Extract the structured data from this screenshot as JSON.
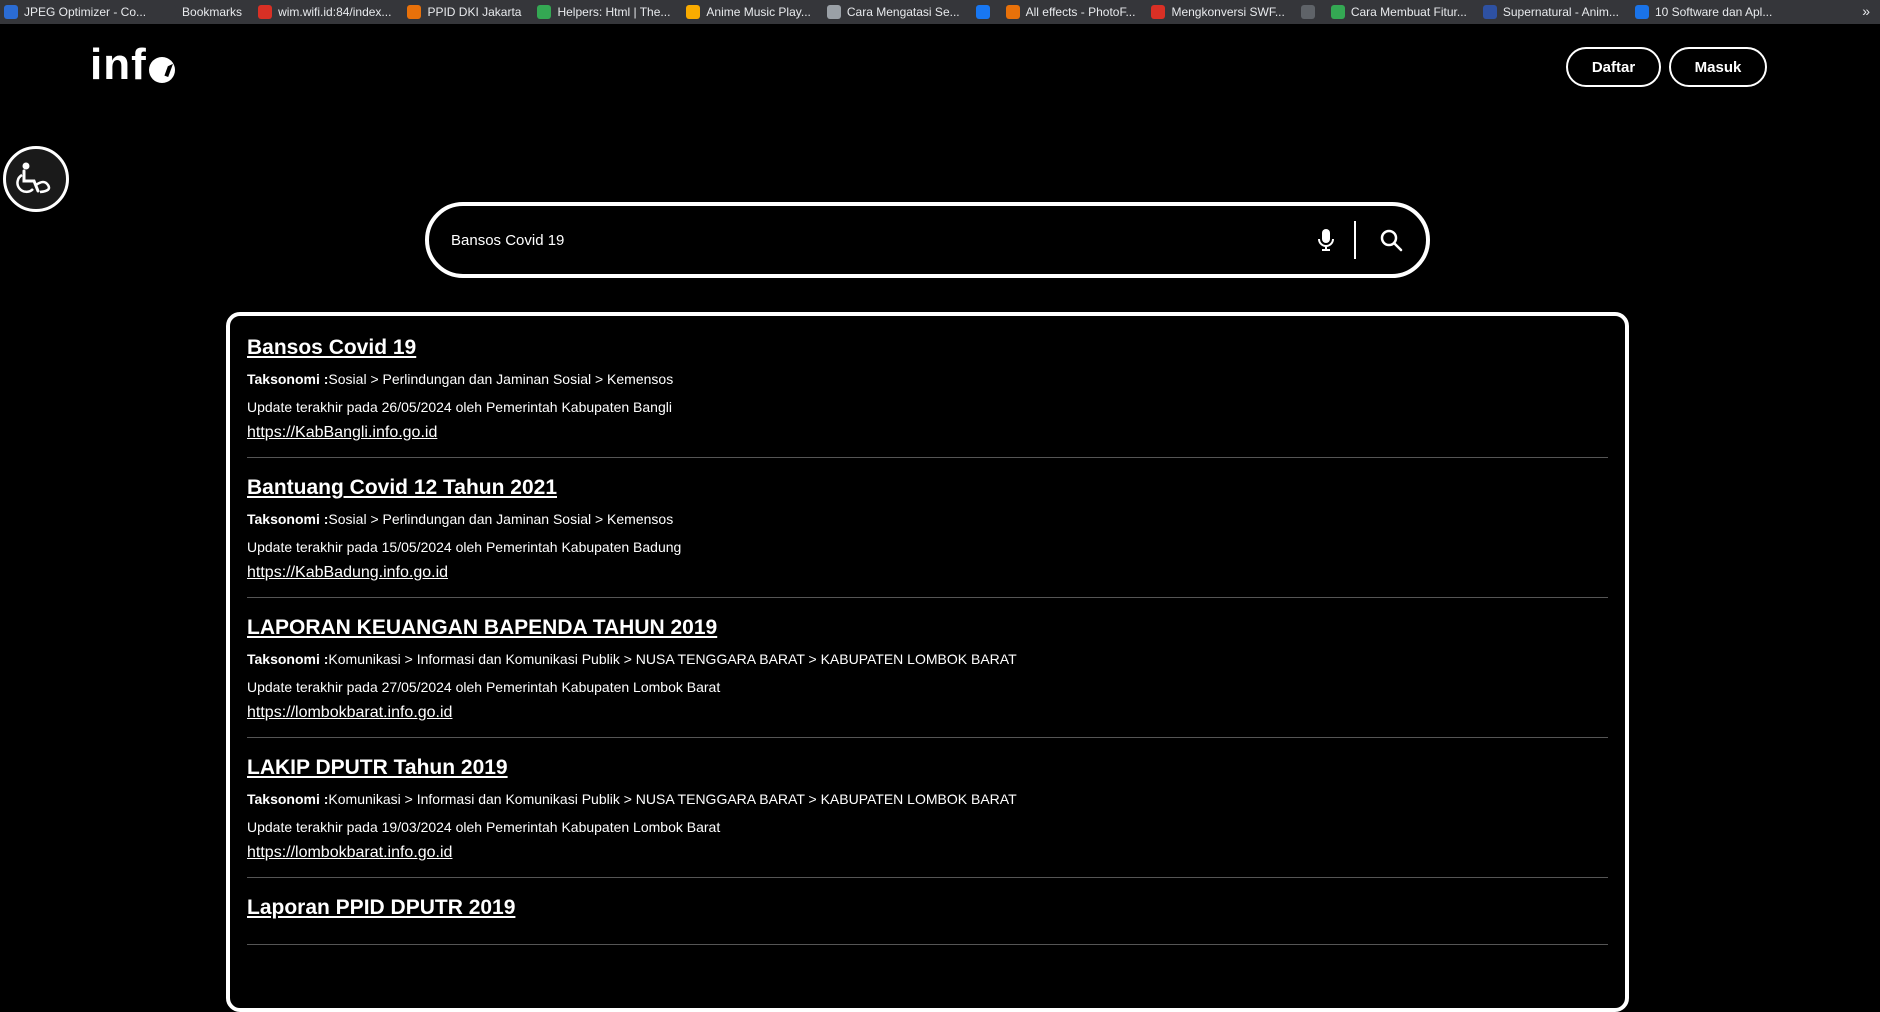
{
  "bookmarks": [
    {
      "label": "JPEG Optimizer - Co...",
      "icon": "jpeg-icon",
      "color": "#2b6cd4"
    },
    {
      "label": "Bookmarks",
      "icon": "star-icon",
      "color": "#35363a"
    },
    {
      "label": "wim.wifi.id:84/index...",
      "icon": "wifi-icon",
      "color": "#d93025"
    },
    {
      "label": "PPID DKI Jakarta",
      "icon": "ppid-icon",
      "color": "#e8710a"
    },
    {
      "label": "Helpers: Html | The...",
      "icon": "helpers-icon",
      "color": "#34a853"
    },
    {
      "label": "Anime Music Play...",
      "icon": "anime-icon",
      "color": "#f9ab00"
    },
    {
      "label": "Cara Mengatasi Se...",
      "icon": "cara-icon",
      "color": "#9aa0a6"
    },
    {
      "label": "",
      "icon": "facebook-icon",
      "color": "#1877f2"
    },
    {
      "label": "All effects - PhotoF...",
      "icon": "photofunia-icon",
      "color": "#e8710a"
    },
    {
      "label": "Mengkonversi SWF...",
      "icon": "swf-icon",
      "color": "#d93025"
    },
    {
      "label": "",
      "icon": "globe-icon",
      "color": "#5f6368"
    },
    {
      "label": "Cara Membuat Fitur...",
      "icon": "blog-icon",
      "color": "#34a853"
    },
    {
      "label": "Supernatural - Anim...",
      "icon": "mal-icon",
      "color": "#2e51a2"
    },
    {
      "label": "10 Software dan Apl...",
      "icon": "software-icon",
      "color": "#1a73e8"
    }
  ],
  "header": {
    "logo_text": "inf",
    "daftar_label": "Daftar",
    "masuk_label": "Masuk"
  },
  "search": {
    "value": "Bansos Covid 19"
  },
  "results": [
    {
      "title": "Bansos Covid 19",
      "taxonomy_label": "Taksonomi :",
      "taxonomy": "Sosial > Perlindungan dan Jaminan Sosial > Kemensos",
      "update": "Update terakhir pada 26/05/2024 oleh Pemerintah Kabupaten Bangli",
      "url": "https://KabBangli.info.go.id"
    },
    {
      "title": "Bantuang Covid 12 Tahun 2021",
      "taxonomy_label": "Taksonomi :",
      "taxonomy": "Sosial > Perlindungan dan Jaminan Sosial > Kemensos",
      "update": "Update terakhir pada 15/05/2024 oleh Pemerintah Kabupaten Badung",
      "url": "https://KabBadung.info.go.id"
    },
    {
      "title": "LAPORAN KEUANGAN BAPENDA TAHUN 2019",
      "taxonomy_label": "Taksonomi :",
      "taxonomy": "Komunikasi > Informasi dan Komunikasi Publik > NUSA TENGGARA BARAT > KABUPATEN LOMBOK BARAT",
      "update": "Update terakhir pada 27/05/2024 oleh Pemerintah Kabupaten Lombok Barat",
      "url": "https://lombokbarat.info.go.id"
    },
    {
      "title": "LAKIP DPUTR Tahun 2019",
      "taxonomy_label": "Taksonomi :",
      "taxonomy": "Komunikasi > Informasi dan Komunikasi Publik > NUSA TENGGARA BARAT > KABUPATEN LOMBOK BARAT",
      "update": "Update terakhir pada 19/03/2024 oleh Pemerintah Kabupaten Lombok Barat",
      "url": "https://lombokbarat.info.go.id"
    },
    {
      "title": "Laporan PPID DPUTR 2019",
      "taxonomy_label": "",
      "taxonomy": "",
      "update": "",
      "url": ""
    }
  ],
  "bookmarks_more": "»"
}
